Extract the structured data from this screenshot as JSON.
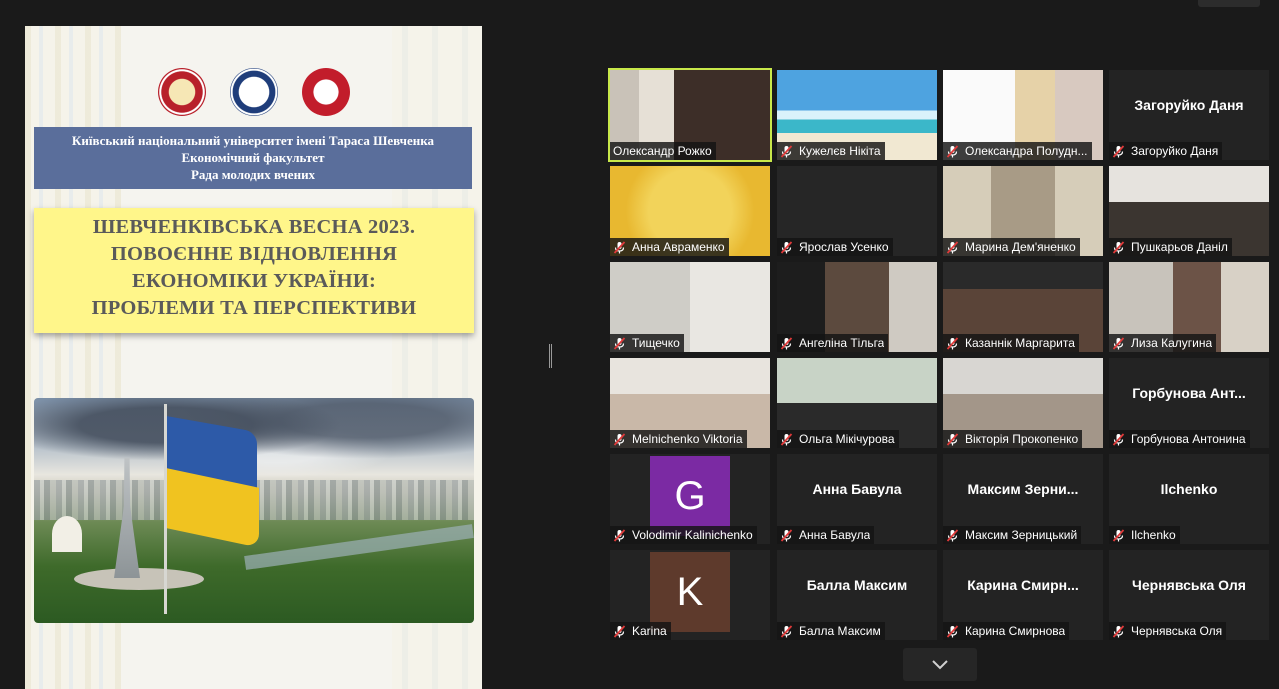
{
  "share": {
    "university_lines": [
      "Київський національний університет імені Тараса Шевченка",
      "Економічний факультет",
      "Рада молодих вчених"
    ],
    "title_lines": [
      "ШЕВЧЕНКІВСЬКА ВЕСНА 2023.",
      "ПОВОЄННЕ ВІДНОВЛЕННЯ",
      "ЕКОНОМІКИ УКРАЇНИ:",
      "ПРОБЛЕМИ ТА ПЕРСПЕКТИВИ"
    ],
    "logo3_text": "ЕФ"
  },
  "participants": [
    {
      "label": "Олександр Рожко",
      "center": "",
      "muted": false,
      "active": true,
      "video": "man-glasses"
    },
    {
      "label": "Кужелєв Нікіта",
      "center": "",
      "muted": true,
      "active": false,
      "video": "beach"
    },
    {
      "label": "Олександра Полудн...",
      "center": "",
      "muted": true,
      "active": false,
      "video": "blonde"
    },
    {
      "label": "Загоруйко Даня",
      "center": "Загоруйко Даня",
      "muted": true,
      "active": false,
      "video": ""
    },
    {
      "label": "Анна Авраменко",
      "center": "",
      "muted": true,
      "active": false,
      "video": "yellow"
    },
    {
      "label": "Ярослав Усенко",
      "center": "",
      "muted": true,
      "active": false,
      "video": "dark"
    },
    {
      "label": "Марина Дем'яненко",
      "center": "",
      "muted": true,
      "active": false,
      "video": "office"
    },
    {
      "label": "Пушкарьов Данiл",
      "center": "",
      "muted": true,
      "active": false,
      "video": "young-man"
    },
    {
      "label": "Тищечко",
      "center": "",
      "muted": true,
      "active": false,
      "video": "two-girls"
    },
    {
      "label": "Ангеліна Тільга",
      "center": "",
      "muted": true,
      "active": false,
      "video": "girl-chair"
    },
    {
      "label": "Казаннік Маргарита",
      "center": "",
      "muted": true,
      "active": false,
      "video": "girl-dark"
    },
    {
      "label": "Лиза Калугина",
      "center": "",
      "muted": true,
      "active": false,
      "video": "girl-room"
    },
    {
      "label": "Melnichenko Viktoria",
      "center": "",
      "muted": true,
      "active": false,
      "video": "girl-light"
    },
    {
      "label": "Ольга Мікічурова",
      "center": "",
      "muted": true,
      "active": false,
      "video": "woman-green"
    },
    {
      "label": "Вікторія Прокопенко",
      "center": "",
      "muted": true,
      "active": false,
      "video": "girl-grey"
    },
    {
      "label": "Горбунова Антонина",
      "center": "Горбунова Ант...",
      "muted": true,
      "active": false,
      "video": ""
    },
    {
      "label": "Volodimir Kalinichenko",
      "center": "",
      "muted": true,
      "active": false,
      "video": "",
      "avatar": "G",
      "avatar_color": "#7b2aa3"
    },
    {
      "label": "Анна Бавула",
      "center": "Анна Бавула",
      "muted": true,
      "active": false,
      "video": ""
    },
    {
      "label": "Максим Зерницький",
      "center": "Максим Зерни...",
      "muted": true,
      "active": false,
      "video": ""
    },
    {
      "label": "Ilchenko",
      "center": "Ilchenko",
      "muted": true,
      "active": false,
      "video": ""
    },
    {
      "label": "Karina",
      "center": "",
      "muted": true,
      "active": false,
      "video": "",
      "avatar": "K",
      "avatar_color": "#5e3a2c"
    },
    {
      "label": "Балла Максим",
      "center": "Балла Максим",
      "muted": true,
      "active": false,
      "video": ""
    },
    {
      "label": "Карина Смирнова",
      "center": "Карина Смирн...",
      "muted": true,
      "active": false,
      "video": ""
    },
    {
      "label": "Чернявська Оля",
      "center": "Чернявська Оля",
      "muted": true,
      "active": false,
      "video": ""
    }
  ],
  "colors": {
    "active_outline": "#c8e84a",
    "mic_muted": "#e03a3a"
  },
  "icons": {
    "mic": "mic-muted-icon",
    "chevron": "chevron-down-icon"
  }
}
